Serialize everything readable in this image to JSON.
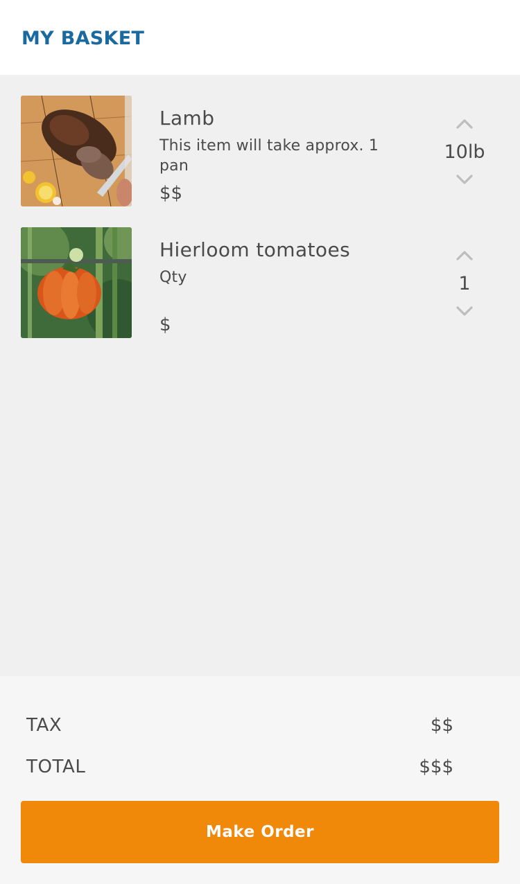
{
  "header": {
    "title": "MY BASKET"
  },
  "items": [
    {
      "name": "Lamb",
      "description": "This item will take approx. 1 pan",
      "price": "$$",
      "quantity": "10lb",
      "image": "roasted-lamb-photo"
    },
    {
      "name": "Hierloom tomatoes",
      "description": "Qty",
      "price": "$",
      "quantity": "1",
      "image": "heirloom-tomato-photo"
    }
  ],
  "icons": {
    "increase": "chevron-up-icon",
    "decrease": "chevron-down-icon"
  },
  "summary": {
    "tax_label": "TAX",
    "tax_value": "$$",
    "total_label": "TOTAL",
    "total_value": "$$$"
  },
  "order_button": {
    "label": "Make Order"
  },
  "colors": {
    "title": "#1a6aa0",
    "accent": "#f0890a",
    "text": "#4a4a4a",
    "chevron": "#bdbdbd",
    "list_background": "#f0f0f0"
  }
}
